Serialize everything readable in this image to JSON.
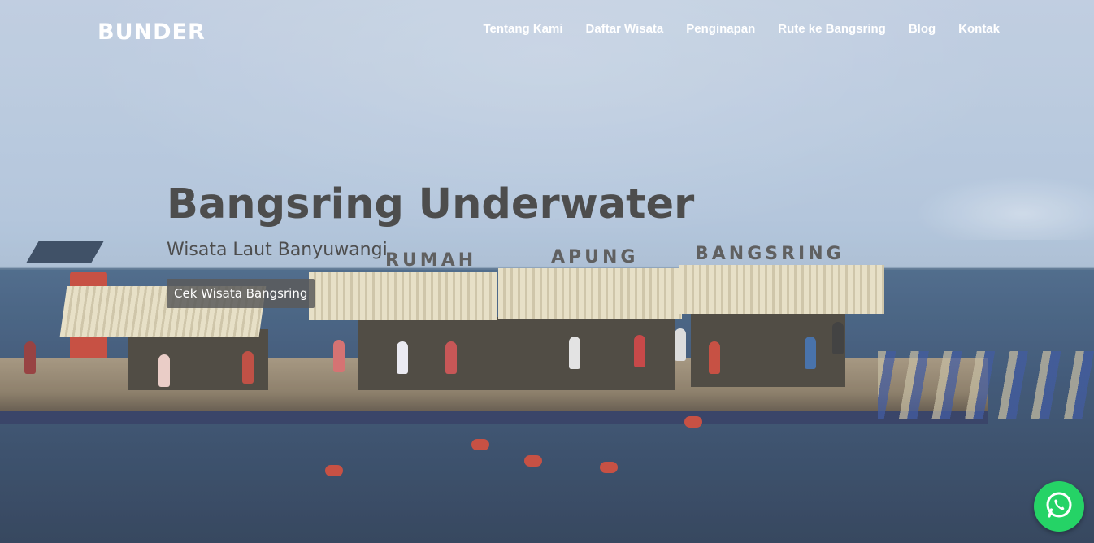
{
  "header": {
    "brand": "BUNDER",
    "nav": [
      "Tentang Kami",
      "Daftar Wisata",
      "Penginapan",
      "Rute ke Bangsring",
      "Blog",
      "Kontak"
    ]
  },
  "hero": {
    "title": "Bangsring Underwater",
    "subtitle": "Wisata Laut Banyuwangi",
    "cta_label": "Cek Wisata Bangsring",
    "photo_sign": [
      "RUMAH",
      "APUNG",
      "BANGSRING"
    ]
  },
  "floating_button": {
    "icon": "whatsapp-icon"
  },
  "colors": {
    "whatsapp": "#25d366",
    "hero_text": "#4d4d4d",
    "button_bg": "#5a5a5a"
  }
}
